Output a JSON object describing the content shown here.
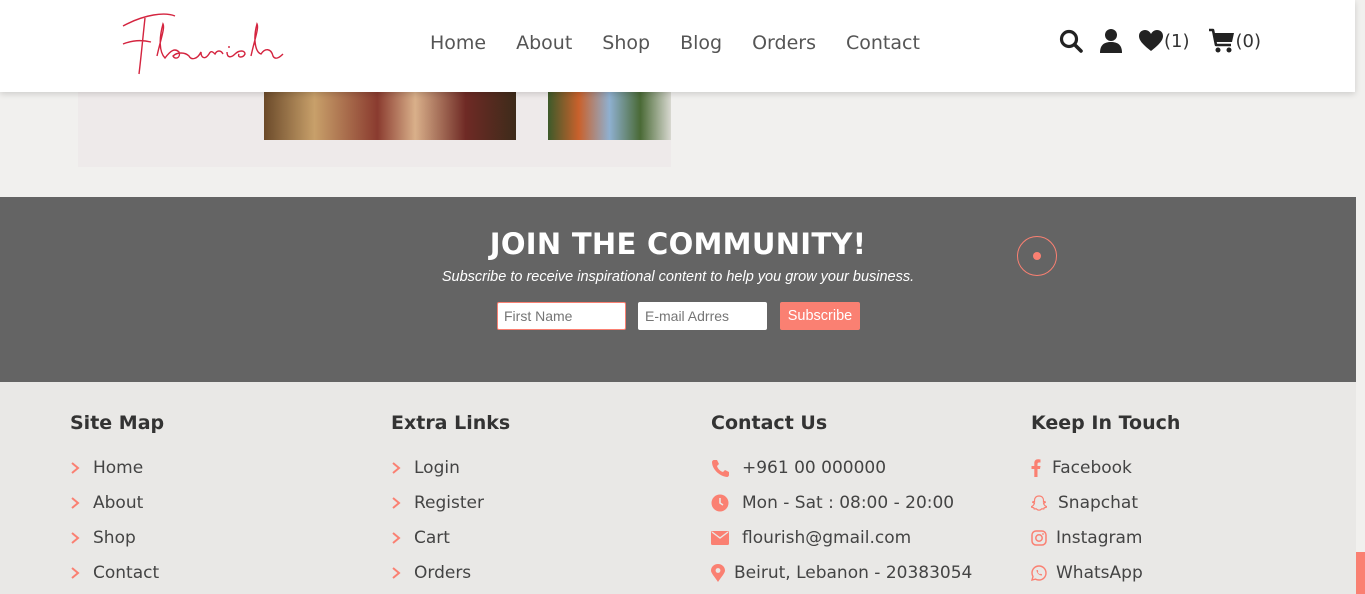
{
  "header": {
    "logo_text": "Flourish",
    "nav": [
      "Home",
      "About",
      "Shop",
      "Blog",
      "Orders",
      "Contact"
    ],
    "wishlist_count": "(1)",
    "cart_count": "(0)"
  },
  "community": {
    "title": "JOIN THE COMMUNITY!",
    "subtitle": "Subscribe to receive inspirational content to help you grow your business.",
    "first_name_placeholder": "First Name",
    "email_placeholder": "E-mail Adrres",
    "subscribe_label": "Subscribe"
  },
  "footer": {
    "site_map": {
      "title": "Site Map",
      "items": [
        "Home",
        "About",
        "Shop",
        "Contact"
      ]
    },
    "extra_links": {
      "title": "Extra Links",
      "items": [
        "Login",
        "Register",
        "Cart",
        "Orders"
      ]
    },
    "contact": {
      "title": "Contact Us",
      "items": [
        {
          "icon": "phone-icon",
          "text": "+961 00 000000"
        },
        {
          "icon": "clock-icon",
          "text": "Mon - Sat : 08:00 - 20:00"
        },
        {
          "icon": "envelope-icon",
          "text": "flourish@gmail.com"
        },
        {
          "icon": "map-pin-icon",
          "text": "Beirut, Lebanon - 20383054"
        }
      ]
    },
    "keep_in_touch": {
      "title": "Keep In Touch",
      "items": [
        {
          "icon": "facebook-icon",
          "text": "Facebook"
        },
        {
          "icon": "snapchat-icon",
          "text": "Snapchat"
        },
        {
          "icon": "instagram-icon",
          "text": "Instagram"
        },
        {
          "icon": "whatsapp-icon",
          "text": "WhatsApp"
        }
      ]
    }
  },
  "colors": {
    "accent": "#fa8072",
    "band": "#646464",
    "footer_bg": "#e9e8e6",
    "logo": "#d4243f"
  }
}
